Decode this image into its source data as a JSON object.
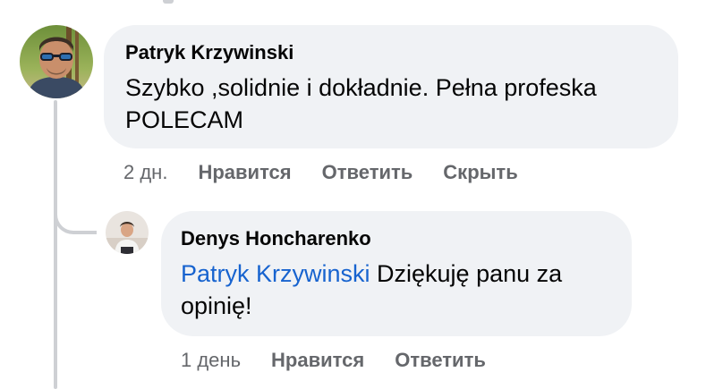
{
  "comment": {
    "author": "Patryk Krzywinski",
    "text_line1": "Szybko ,solidnie i dokładnie. Pełna profeska",
    "text_line2": "POLECAM",
    "timestamp": "2 дн.",
    "like_label": "Нравится",
    "reply_label": "Ответить",
    "hide_label": "Скрыть"
  },
  "reply": {
    "author": "Denys Honcharenko",
    "mention": "Patryk Krzywinski",
    "text_after_mention": " Dziękuję panu za",
    "text_line2": "opinię!",
    "timestamp": "1 день",
    "like_label": "Нравится",
    "reply_label": "Ответить"
  },
  "colors": {
    "bubble_bg": "#f0f2f5",
    "mention": "#1763cf",
    "meta_text": "#65676b",
    "thread_line": "#ced0d4"
  }
}
